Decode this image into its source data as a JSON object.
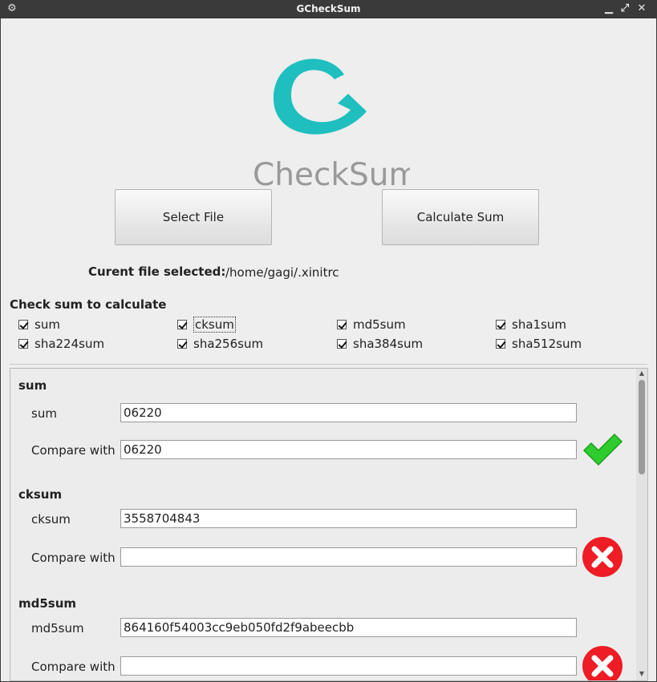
{
  "window": {
    "title": "GCheckSum"
  },
  "titlebar": {
    "menu_icon": "gear-icon",
    "minimize_icon": "minimize-icon",
    "maximize_icon": "maximize-icon",
    "close_icon": "close-icon"
  },
  "logo": {
    "text": "CheckSum",
    "letter": "G",
    "color": "#1fbfbf",
    "text_color": "#999999"
  },
  "buttons": {
    "select_file": "Select File",
    "calculate_sum": "Calculate Sum"
  },
  "current_file": {
    "label": "Curent file selected:",
    "value": "/home/gagi/.xinitrc"
  },
  "checksums": {
    "title": "Check sum to calculate",
    "options": [
      {
        "label": "sum",
        "checked": true
      },
      {
        "label": "cksum",
        "checked": true
      },
      {
        "label": "md5sum",
        "checked": true
      },
      {
        "label": "sha1sum",
        "checked": true
      },
      {
        "label": "sha224sum",
        "checked": true
      },
      {
        "label": "sha256sum",
        "checked": true
      },
      {
        "label": "sha384sum",
        "checked": true
      },
      {
        "label": "sha512sum",
        "checked": true
      }
    ]
  },
  "results": [
    {
      "title": "sum",
      "label": "sum",
      "value": "06220",
      "compare_label": "Compare with",
      "compare_value": "06220",
      "status": "match",
      "status_icon": "checkmark-icon",
      "status_color": "#2ecc2e"
    },
    {
      "title": "cksum",
      "label": "cksum",
      "value": "3558704843",
      "compare_label": "Compare with",
      "compare_value": "",
      "status": "mismatch",
      "status_icon": "error-x-icon",
      "status_color": "#ee1c24"
    },
    {
      "title": "md5sum",
      "label": "md5sum",
      "value": "864160f54003cc9eb050fd2f9abeecbb",
      "compare_label": "Compare with",
      "compare_value": "",
      "status": "mismatch",
      "status_icon": "error-x-icon",
      "status_color": "#ee1c24"
    }
  ]
}
